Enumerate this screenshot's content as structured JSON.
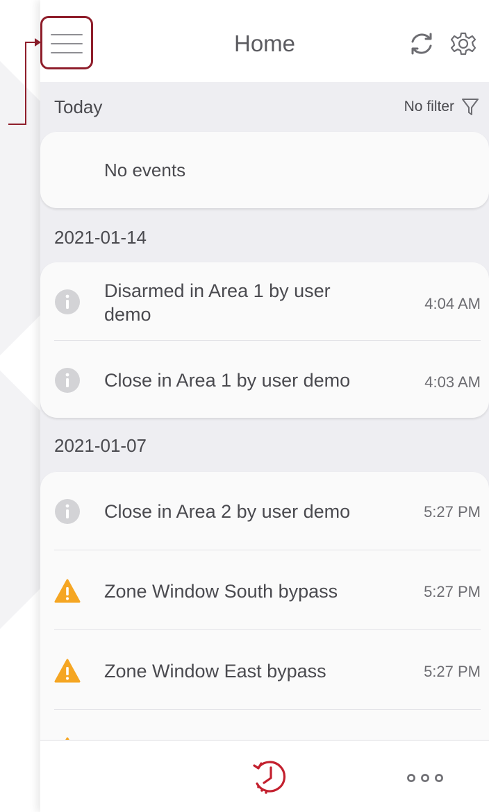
{
  "header": {
    "title": "Home"
  },
  "sections": [
    {
      "date": "Today",
      "filter_label": "No filter",
      "empty_text": "No events"
    },
    {
      "date": "2021-01-14",
      "events": [
        {
          "icon": "info-icon",
          "text": "Disarmed in Area 1 by user demo",
          "time": "4:04 AM"
        },
        {
          "icon": "info-icon",
          "text": "Close in Area 1 by user demo",
          "time": "4:03 AM"
        }
      ]
    },
    {
      "date": "2021-01-07",
      "events": [
        {
          "icon": "info-icon",
          "text": "Close in Area 2 by user demo",
          "time": "5:27 PM"
        },
        {
          "icon": "warning-icon",
          "text": "Zone Window South bypass",
          "time": "5:27 PM"
        },
        {
          "icon": "warning-icon",
          "text": "Zone Window East bypass",
          "time": "5:27 PM"
        }
      ]
    }
  ],
  "tabbar": {
    "items": [
      {
        "icon": "history-icon",
        "active": true
      },
      {
        "icon": "more-icon",
        "active": false
      }
    ]
  },
  "colors": {
    "accent": "#c3202e",
    "callout": "#8f1e2b",
    "warning": "#f5a623",
    "info": "#d3d3d6",
    "list_background": "#eeeef2"
  }
}
